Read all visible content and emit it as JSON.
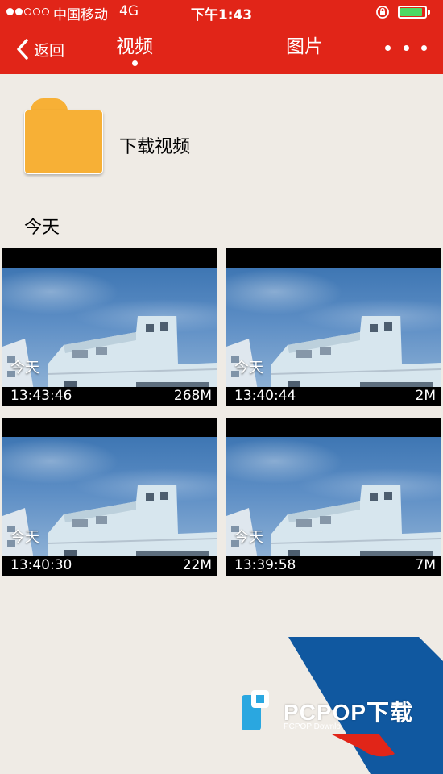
{
  "status_bar": {
    "carrier": "中国移动",
    "network": "4G",
    "time": "下午1:43",
    "signal_filled": 2,
    "signal_total": 5,
    "battery_level": 0.9,
    "rotation_icon": "rotation-lock-icon"
  },
  "header": {
    "background_color": "#e12518",
    "back_label": "返回",
    "tabs": [
      {
        "label": "视频",
        "active": true
      },
      {
        "label": "图片",
        "active": false
      }
    ],
    "more_icon": "more-dots-icon"
  },
  "folder": {
    "label": "下载视频",
    "color": "#f7b036"
  },
  "section": {
    "title": "今天"
  },
  "videos": [
    {
      "badge": "今天",
      "timestamp": "13:43:46",
      "size": "268M"
    },
    {
      "badge": "今天",
      "timestamp": "13:40:44",
      "size": "2M"
    },
    {
      "badge": "今天",
      "timestamp": "13:40:30",
      "size": "22M"
    },
    {
      "badge": "今天",
      "timestamp": "13:39:58",
      "size": "7M"
    }
  ],
  "watermark": {
    "brand": "PCPOP下载",
    "subtitle": "PCPOP Downlo"
  }
}
